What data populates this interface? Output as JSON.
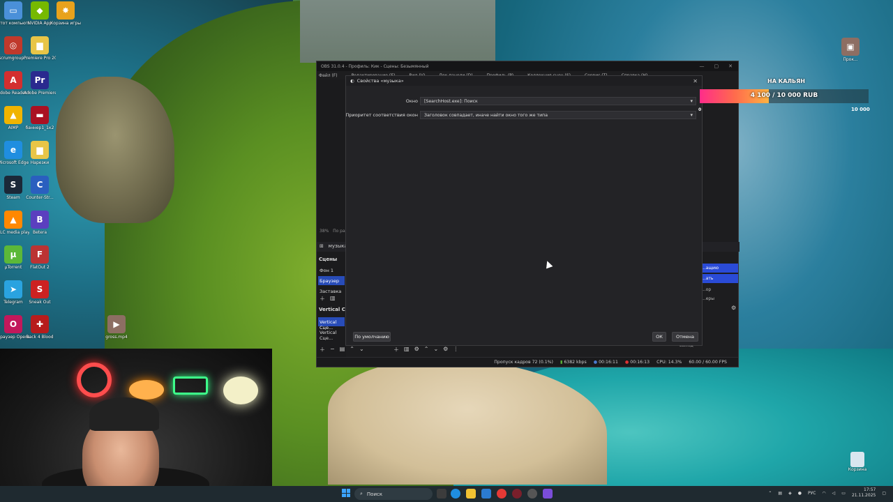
{
  "desktop": {
    "icons": [
      {
        "label": "Этот компьютер",
        "color": "#4a90d9",
        "glyph": "▭"
      },
      {
        "label": "NVIDIA App",
        "color": "#76b900",
        "glyph": "◆"
      },
      {
        "label": "Корзина игры",
        "color": "#e8a21c",
        "glyph": "✸"
      },
      {
        "label": "scrumgroup...",
        "color": "#c0392b",
        "glyph": "◎"
      },
      {
        "label": "Premiere Pro 2024 (24.2...",
        "color": "#e8c547",
        "glyph": "▆"
      },
      {
        "label": "Adobe Reader XI",
        "color": "#d32f2f",
        "glyph": "A"
      },
      {
        "label": "Adobe Premiere P...",
        "color": "#2a2a8f",
        "glyph": "Pr"
      },
      {
        "label": "AIMP",
        "color": "#f0b400",
        "glyph": "▲"
      },
      {
        "label": "баннер1_1к2",
        "color": "#a12",
        "glyph": "▬"
      },
      {
        "label": "Microsoft Edge",
        "color": "#1f8ee0",
        "glyph": "e"
      },
      {
        "label": "Нарезки",
        "color": "#e8c547",
        "glyph": "▆"
      },
      {
        "label": "Steam",
        "color": "#1b2838",
        "glyph": "S"
      },
      {
        "label": "Counter-Str...",
        "color": "#2a5fbf",
        "glyph": "C"
      },
      {
        "label": "VLC media player",
        "color": "#ff8800",
        "glyph": "▲"
      },
      {
        "label": "Betera",
        "color": "#5b3fbf",
        "glyph": "B"
      },
      {
        "label": "µTorrent",
        "color": "#5cb838",
        "glyph": "µ"
      },
      {
        "label": "FlatOut 2",
        "color": "#b33",
        "glyph": "F"
      },
      {
        "label": "Telegram",
        "color": "#2aa3e0",
        "glyph": "➤"
      },
      {
        "label": "Sneak Out",
        "color": "#c22",
        "glyph": "S"
      },
      {
        "label": "Браузер Opera GX",
        "color": "#c2185b",
        "glyph": "O"
      },
      {
        "label": "Back 4 Blood",
        "color": "#b71c1c",
        "glyph": "✚"
      },
      {
        "label": "gross.mp4",
        "color": "#8d6e63",
        "glyph": "▶"
      }
    ],
    "trash_label": "Корзина",
    "right_icon_label": "Прок..."
  },
  "obs": {
    "title": "OBS 31.0.4 - Профиль: Кик - Сцены: Безымянный",
    "menu": [
      "Файл (F)",
      "Редактирование (E)",
      "Вид (V)",
      "Док-панели (D)",
      "Профиль (P)",
      "Коллекция сцен (S)",
      "Сервис (T)",
      "Справка (H)"
    ],
    "zoom": "38%",
    "preview_hint": "По ра...",
    "source_bar": "музыка",
    "scenes_header": "Сцены",
    "scenes": [
      "Фон 1",
      "Браузер",
      "Заставка"
    ],
    "selected_scene": "Браузер",
    "vertical_header": "Vertical Сце...",
    "vertical_scenes": [
      "Vertical Сце...",
      "Vertical Сце..."
    ],
    "right_items": [
      "...ащию",
      "...ать"
    ],
    "right_misc": [
      "...ор",
      "...еры"
    ],
    "exit_label": "выход",
    "status": {
      "dropped": "Пропуск кадров 72 (0.1%)",
      "bitrate": "6382 kbps",
      "stream_time": "00:16:11",
      "rec_time": "00:16:13",
      "cpu": "CPU: 14.3%",
      "fps": "60.00 / 60.00 FPS"
    }
  },
  "dialog": {
    "title": "Свойства «музыка»",
    "window_label": "Окно",
    "window_value": "[SearchHost.exe]: Поиск",
    "priority_label": "Приоритет соответствия окон",
    "priority_value": "Заголовок совпадает, иначе найти окно того же типа",
    "defaults_button": "По умолчанию",
    "ok_button": "ОК",
    "cancel_button": "Отмена"
  },
  "widget": {
    "title": "НА КАЛЬЯН",
    "progress_text": "4 100 / 10 000 RUB",
    "progress_fraction": 0.41,
    "min_label": "0",
    "max_label": "10 000"
  },
  "taskbar": {
    "search_placeholder": "Поиск",
    "language": "РУС",
    "time": "17:57",
    "date": "21.11.2025"
  }
}
